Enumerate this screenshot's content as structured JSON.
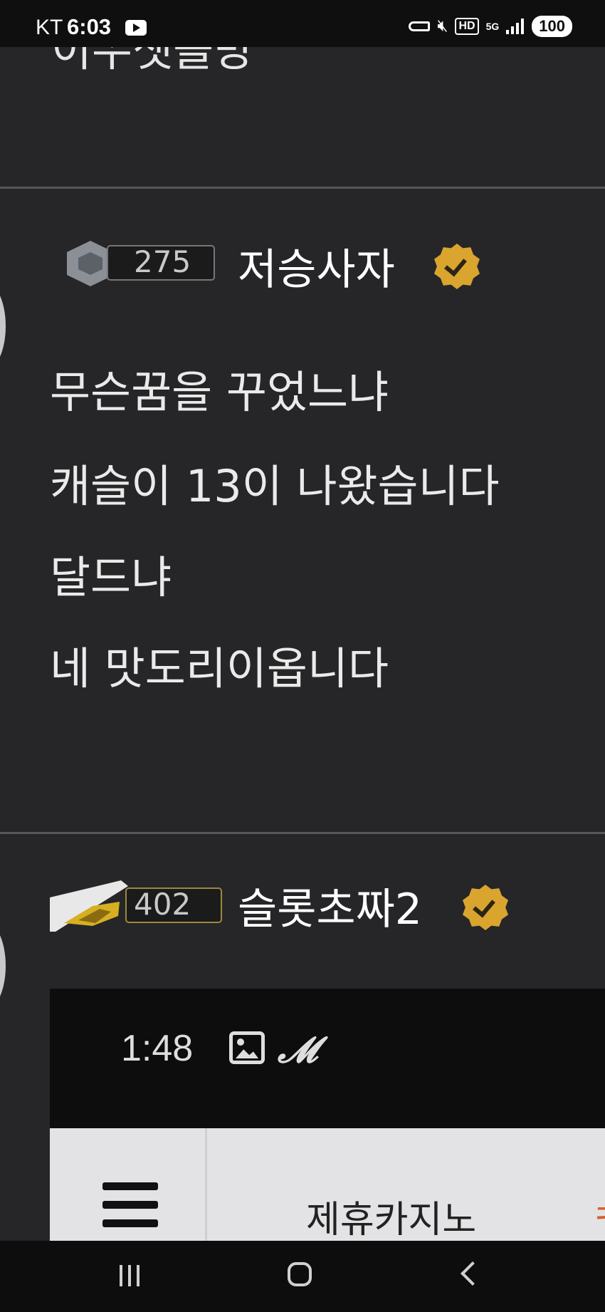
{
  "status_bar": {
    "carrier": "KT",
    "time": "6:03",
    "hd_label": "HD",
    "network": "5G",
    "battery": "100"
  },
  "feed": {
    "partial_text": "이쑤셋을방",
    "posts": [
      {
        "level": "275",
        "username": "저승사자",
        "lines": [
          "무슨꿈을 꾸었느냐",
          "캐슬이 13이 나왔습니다",
          "달드냐",
          "네 맛도리이옵니다"
        ]
      },
      {
        "level": "402",
        "username": "슬롯초짜2"
      }
    ]
  },
  "embed": {
    "time": "1:48",
    "title": "제휴카지노",
    "cut_text": "ㅋ",
    "colors": {
      "cut_accent": "#d4622c"
    }
  },
  "colors": {
    "background": "#262628",
    "verified": "#d9a52e",
    "divider": "#56575a"
  }
}
